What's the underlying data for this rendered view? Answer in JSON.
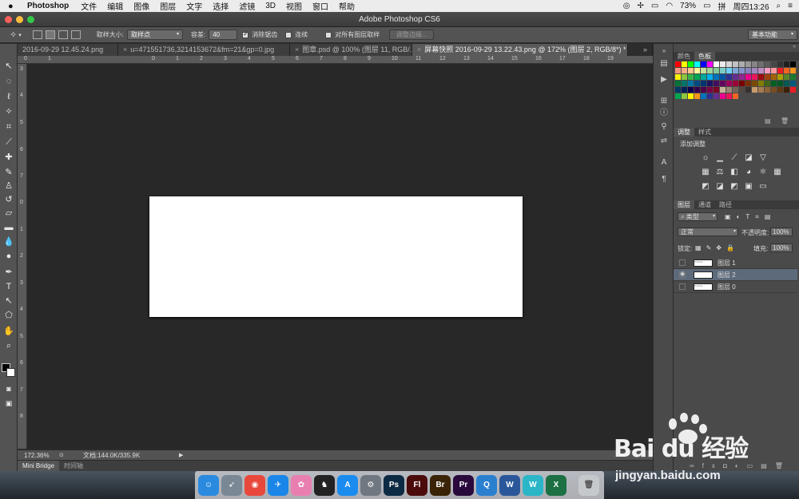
{
  "menubar": {
    "app_name": "Photoshop",
    "items": [
      "文件",
      "编辑",
      "图像",
      "图层",
      "文字",
      "选择",
      "滤镜",
      "3D",
      "视图",
      "窗口",
      "帮助"
    ],
    "battery": "73%",
    "clock": "周四13:26"
  },
  "window": {
    "title": "Adobe Photoshop CS6"
  },
  "options": {
    "sample_size_label": "取样大小:",
    "sample_size_value": "取样点",
    "tolerance_label": "容差:",
    "tolerance_value": "40",
    "antialias_label": "消除锯齿",
    "contiguous_label": "连续",
    "all_layers_label": "对所有图层取样",
    "refine_edge_label": "调整边缘...",
    "workspace_value": "基本功能"
  },
  "tabs": [
    {
      "label": "2016-09-29 12.45.24.png",
      "active": false
    },
    {
      "label": "u=471551736,3214153672&fm=21&gp=0.jpg",
      "active": false
    },
    {
      "label": "图章.psd @ 100% (图层 11, RGB/...",
      "active": false
    },
    {
      "label": "屏幕快照 2016-09-29 13.22.43.png @ 172% (图层 2, RGB/8*) *",
      "active": true
    }
  ],
  "ruler": {
    "top": [
      "0",
      "1",
      "0",
      "1",
      "2",
      "3",
      "4",
      "5",
      "6",
      "7",
      "8",
      "9",
      "10",
      "11",
      "12",
      "13",
      "14",
      "15",
      "16",
      "17",
      "18",
      "19"
    ],
    "left": [
      "3",
      "4",
      "5",
      "6",
      "7",
      "0",
      "1",
      "2",
      "3",
      "4",
      "5",
      "6",
      "7",
      "8"
    ]
  },
  "status": {
    "zoom": "172.36%",
    "doc_info": "文档:144.0K/335.9K"
  },
  "bottom_tabs": [
    "Mini Bridge",
    "时间轴"
  ],
  "panels": {
    "color_tabs": [
      "颜色",
      "色板"
    ],
    "swatch_colors": [
      "#ff0000",
      "#ffff00",
      "#00ff00",
      "#00ffff",
      "#0000ff",
      "#ff00ff",
      "#ffffff",
      "#ebebeb",
      "#d6d6d6",
      "#c2c2c2",
      "#adadad",
      "#999999",
      "#858585",
      "#707070",
      "#5c5c5c",
      "#474747",
      "#333333",
      "#1f1f1f",
      "#000000",
      "#f7977a",
      "#f9ad81",
      "#fdc68a",
      "#fff79a",
      "#c4df9b",
      "#a2d39c",
      "#82ca9d",
      "#7bcdc8",
      "#6ecff6",
      "#7ea7d8",
      "#8493ca",
      "#8882be",
      "#a187be",
      "#bc8dbf",
      "#f49ac2",
      "#f6989d",
      "#ed1c24",
      "#f26522",
      "#f7941d",
      "#fff200",
      "#8dc63f",
      "#39b54a",
      "#00a651",
      "#00a99d",
      "#00aeef",
      "#0072bc",
      "#0054a6",
      "#2e3192",
      "#662d91",
      "#92278f",
      "#ec008c",
      "#ed145b",
      "#9e0b0f",
      "#a0410d",
      "#a3620a",
      "#aba000",
      "#598527",
      "#1a7b30",
      "#007236",
      "#00746b",
      "#0076a3",
      "#004b80",
      "#003471",
      "#1b1464",
      "#440e62",
      "#630460",
      "#9e005d",
      "#9e0039",
      "#790000",
      "#7b2e00",
      "#7d4900",
      "#827b00",
      "#406618",
      "#005e20",
      "#005826",
      "#005952",
      "#005b7f",
      "#003663",
      "#002157",
      "#0d004c",
      "#32004b",
      "#4b0049",
      "#7b0046",
      "#7a0026",
      "#c7b299",
      "#998675",
      "#736357",
      "#534741",
      "#37302d",
      "#c69c6d",
      "#a67c52",
      "#8c6239",
      "#754c24",
      "#603913",
      "#3c1f08",
      "#ed1c24",
      "#00a651",
      "#8dc63f",
      "#fff200",
      "#f7941d",
      "#0072bc",
      "#2e3192",
      "#662d91",
      "#ec008c",
      "#ed145b",
      "#f26522"
    ],
    "adjust_tabs": [
      "调整",
      "样式"
    ],
    "add_adjustment": "添加调整",
    "layer_tabs": [
      "图层",
      "通道",
      "路径"
    ],
    "layer_filter": "类型",
    "blend_mode": "正常",
    "opacity_label": "不透明度:",
    "opacity_value": "100%",
    "lock_label": "锁定:",
    "fill_label": "填充:",
    "fill_value": "100%",
    "layers": [
      {
        "name": "图层 1",
        "visible": false,
        "selected": false
      },
      {
        "name": "图层 2",
        "visible": true,
        "selected": true
      },
      {
        "name": "图层 0",
        "visible": false,
        "selected": false
      }
    ]
  },
  "dock": {
    "apps": [
      {
        "label": "☺",
        "color": "#2a8ae0"
      },
      {
        "label": "➶",
        "color": "#7a8794"
      },
      {
        "label": "◉",
        "color": "#e8483b"
      },
      {
        "label": "✈",
        "color": "#1a86e8"
      },
      {
        "label": "✿",
        "color": "#e97fb1"
      },
      {
        "label": "♞",
        "color": "#222222"
      },
      {
        "label": "A",
        "color": "#1a8cf0"
      },
      {
        "label": "⚙",
        "color": "#6f7780"
      },
      {
        "label": "Ps",
        "color": "#0d2a44"
      },
      {
        "label": "Fl",
        "color": "#4b0b0b"
      },
      {
        "label": "Br",
        "color": "#3a2306"
      },
      {
        "label": "Pr",
        "color": "#2a0a3c"
      },
      {
        "label": "Q",
        "color": "#2b7fcf"
      },
      {
        "label": "W",
        "color": "#2b579a"
      },
      {
        "label": "W",
        "color": "#2bb6c8"
      },
      {
        "label": "X",
        "color": "#1d7044"
      },
      {
        "label": "🗑",
        "color": "#c6c9cc"
      }
    ]
  },
  "watermark": {
    "logo": "Bai du 经验",
    "url": "jingyan.baidu.com"
  }
}
